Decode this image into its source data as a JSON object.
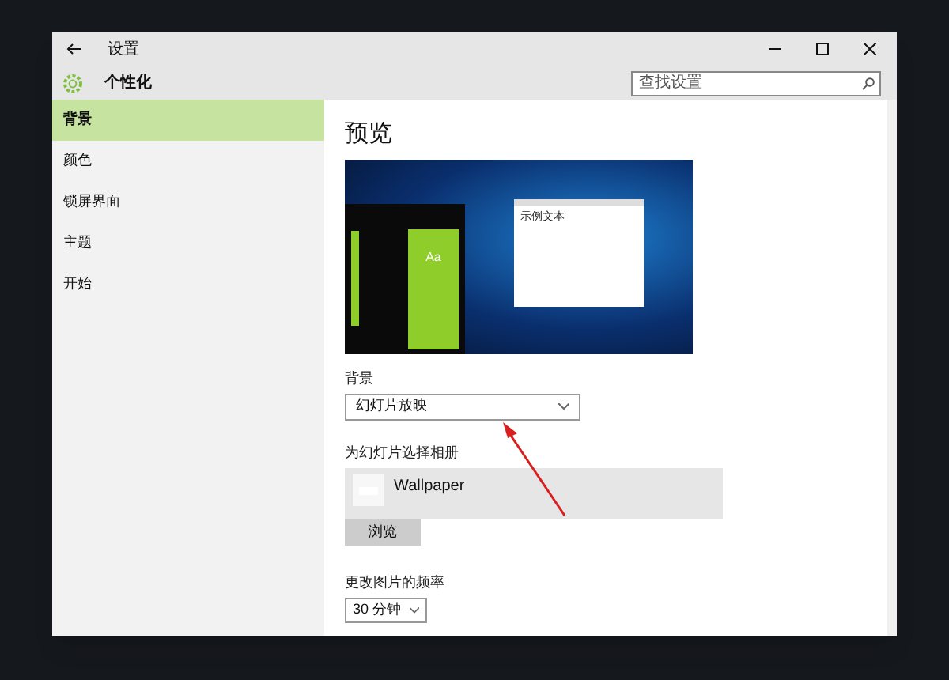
{
  "window": {
    "title": "设置"
  },
  "header": {
    "title": "个性化",
    "search": {
      "placeholder": "查找设置"
    }
  },
  "sidebar": {
    "items": [
      {
        "label": "背景",
        "selected": true
      },
      {
        "label": "颜色",
        "selected": false
      },
      {
        "label": "锁屏界面",
        "selected": false
      },
      {
        "label": "主题",
        "selected": false
      },
      {
        "label": "开始",
        "selected": false
      }
    ]
  },
  "content": {
    "heading": "预览",
    "preview": {
      "tile_text": "Aa",
      "sample_text": "示例文本"
    },
    "background": {
      "label": "背景",
      "value": "幻灯片放映"
    },
    "album": {
      "label": "为幻灯片选择相册",
      "name": "Wallpaper",
      "button": "浏览"
    },
    "frequency": {
      "label": "更改图片的频率",
      "value": "30 分钟"
    }
  }
}
